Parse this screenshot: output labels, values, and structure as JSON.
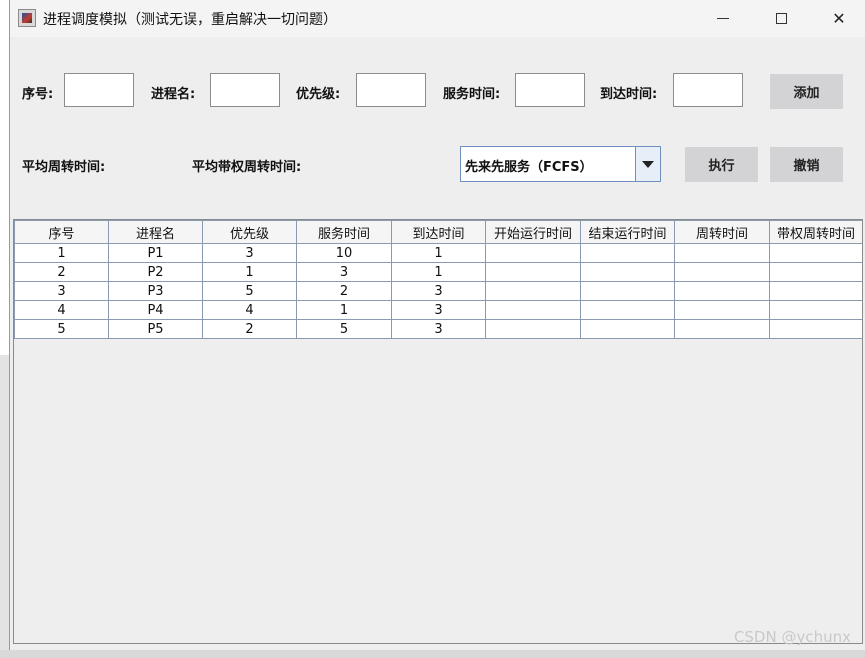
{
  "window": {
    "title": "进程调度模拟（测试无误，重启解决一切问题）",
    "close_glyph": "✕"
  },
  "form": {
    "id_label": "序号:",
    "name_label": "进程名:",
    "priority_label": "优先级:",
    "service_label": "服务时间:",
    "arrival_label": "到达时间:",
    "add_button": "添加",
    "id_value": "",
    "name_value": "",
    "priority_value": "",
    "service_value": "",
    "arrival_value": ""
  },
  "stats": {
    "avg_turnaround_label": "平均周转时间:",
    "avg_weighted_turnaround_label": "平均带权周转时间:"
  },
  "controls": {
    "algorithm_selected": "先来先服务（FCFS）",
    "execute_button": "执行",
    "undo_button": "撤销"
  },
  "table": {
    "columns": [
      "序号",
      "进程名",
      "优先级",
      "服务时间",
      "到达时间",
      "开始运行时间",
      "结束运行时间",
      "周转时间",
      "带权周转时间"
    ],
    "rows": [
      [
        "1",
        "P1",
        "3",
        "10",
        "1",
        "",
        "",
        "",
        ""
      ],
      [
        "2",
        "P2",
        "1",
        "3",
        "1",
        "",
        "",
        "",
        ""
      ],
      [
        "3",
        "P3",
        "5",
        "2",
        "3",
        "",
        "",
        "",
        ""
      ],
      [
        "4",
        "P4",
        "4",
        "1",
        "3",
        "",
        "",
        "",
        ""
      ],
      [
        "5",
        "P5",
        "2",
        "5",
        "3",
        "",
        "",
        "",
        ""
      ]
    ]
  },
  "watermark": "CSDN @ychunx",
  "colors": {
    "window_bg": "#eeeeee",
    "button_bg": "#d3d3d5",
    "select_border": "#6f8fbf",
    "grid_line": "#8a9ab0"
  },
  "icons": {
    "app": "java-cup-icon",
    "minimize": "minimize-icon",
    "maximize": "maximize-icon",
    "close": "close-icon",
    "dropdown": "chevron-down-icon"
  }
}
